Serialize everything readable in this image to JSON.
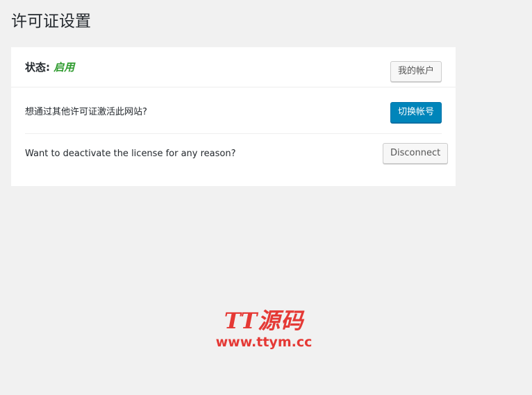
{
  "page": {
    "title": "许可证设置"
  },
  "license_card": {
    "status_label": "状态:",
    "status_value": "启用",
    "my_account_button": "我的帐户",
    "switch_row": {
      "text": "想通过其他许可证激活此网站?",
      "button": "切换帐号"
    },
    "disconnect_row": {
      "text": "Want to deactivate the license for any reason?",
      "button": "Disconnect"
    }
  },
  "watermark": {
    "logo": "TT源码",
    "url": "www.ttym.cc"
  },
  "colors": {
    "background": "#f1f1f1",
    "card": "#ffffff",
    "status_active": "#2e9b2e",
    "primary_button": "#0085ba",
    "watermark": "#e53935"
  }
}
